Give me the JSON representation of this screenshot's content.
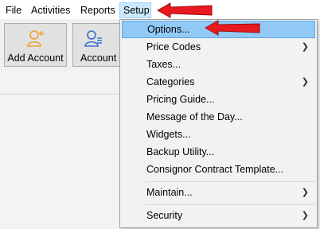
{
  "menubar": {
    "items": [
      {
        "label": "File"
      },
      {
        "label": "Activities"
      },
      {
        "label": "Reports"
      },
      {
        "label": "Setup"
      }
    ]
  },
  "toolbar": {
    "buttons": [
      {
        "label": "Add Account",
        "icon": "add-account-icon"
      },
      {
        "label": "Account L",
        "icon": "account-list-icon"
      }
    ]
  },
  "setup_menu": {
    "items": [
      {
        "label": "Options...",
        "has_submenu": false,
        "highlighted": true
      },
      {
        "label": "Price Codes",
        "has_submenu": true
      },
      {
        "label": "Taxes...",
        "has_submenu": false
      },
      {
        "label": "Categories",
        "has_submenu": true
      },
      {
        "label": "Pricing Guide...",
        "has_submenu": false
      },
      {
        "label": "Message of the Day...",
        "has_submenu": false
      },
      {
        "label": "Widgets...",
        "has_submenu": false
      },
      {
        "label": "Backup Utility...",
        "has_submenu": false
      },
      {
        "label": "Consignor Contract Template...",
        "has_submenu": false
      },
      {
        "label": "Maintain...",
        "has_submenu": true
      },
      {
        "label": "Security",
        "has_submenu": true
      }
    ]
  },
  "colors": {
    "highlight": "#91c9f7",
    "active_menubar": "#cce8ff",
    "annotation_arrow": "#e8191f",
    "icon_orange": "#f0a030",
    "icon_blue": "#3d6fd8"
  }
}
